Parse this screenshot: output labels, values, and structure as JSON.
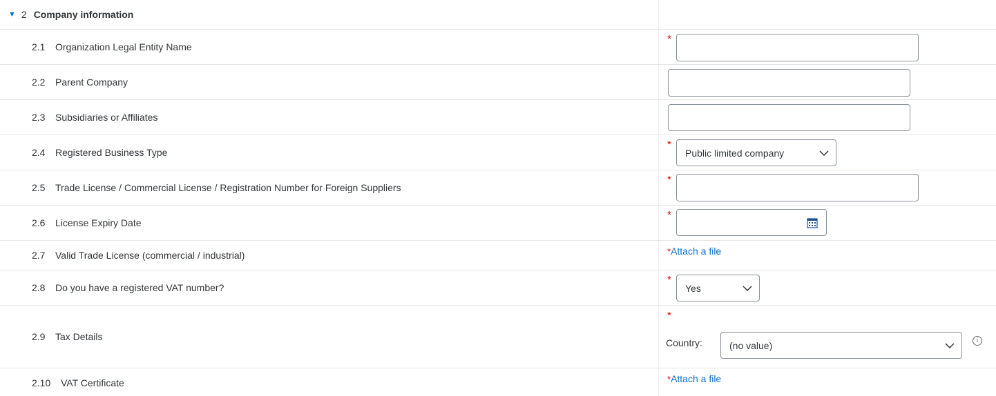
{
  "section": {
    "number": "2",
    "title": "Company information"
  },
  "rows": [
    {
      "num": "2.1",
      "label": "Organization Legal Entity Name",
      "required": "*",
      "value": ""
    },
    {
      "num": "2.2",
      "label": "Parent Company",
      "value": ""
    },
    {
      "num": "2.3",
      "label": "Subsidiaries or Affiliates",
      "value": ""
    },
    {
      "num": "2.4",
      "label": "Registered Business Type",
      "required": "*",
      "selected": "Public limited company"
    },
    {
      "num": "2.5",
      "label": "Trade License / Commercial License / Registration Number for Foreign Suppliers",
      "required": "*",
      "value": ""
    },
    {
      "num": "2.6",
      "label": "License Expiry Date",
      "required": "*",
      "value": ""
    },
    {
      "num": "2.7",
      "label": "Valid Trade License (commercial / industrial)",
      "required": "*",
      "link": "Attach a file"
    },
    {
      "num": "2.8",
      "label": "Do you have a registered VAT number?",
      "required": "*",
      "selected": "Yes"
    },
    {
      "num": "2.9",
      "label": "Tax Details",
      "required": "*",
      "country_label": "Country:",
      "selected": "(no value)"
    },
    {
      "num": "2.10",
      "label": "VAT Certificate",
      "required": "*",
      "link": "Attach a file"
    }
  ],
  "icons": {
    "expand": "triangle-down-icon",
    "dropdown": "chevron-down-icon",
    "date": "calendar-icon",
    "info": "info-icon"
  },
  "colors": {
    "accent": "#0a6ed1",
    "required": "#e00000",
    "border": "#89919a"
  }
}
